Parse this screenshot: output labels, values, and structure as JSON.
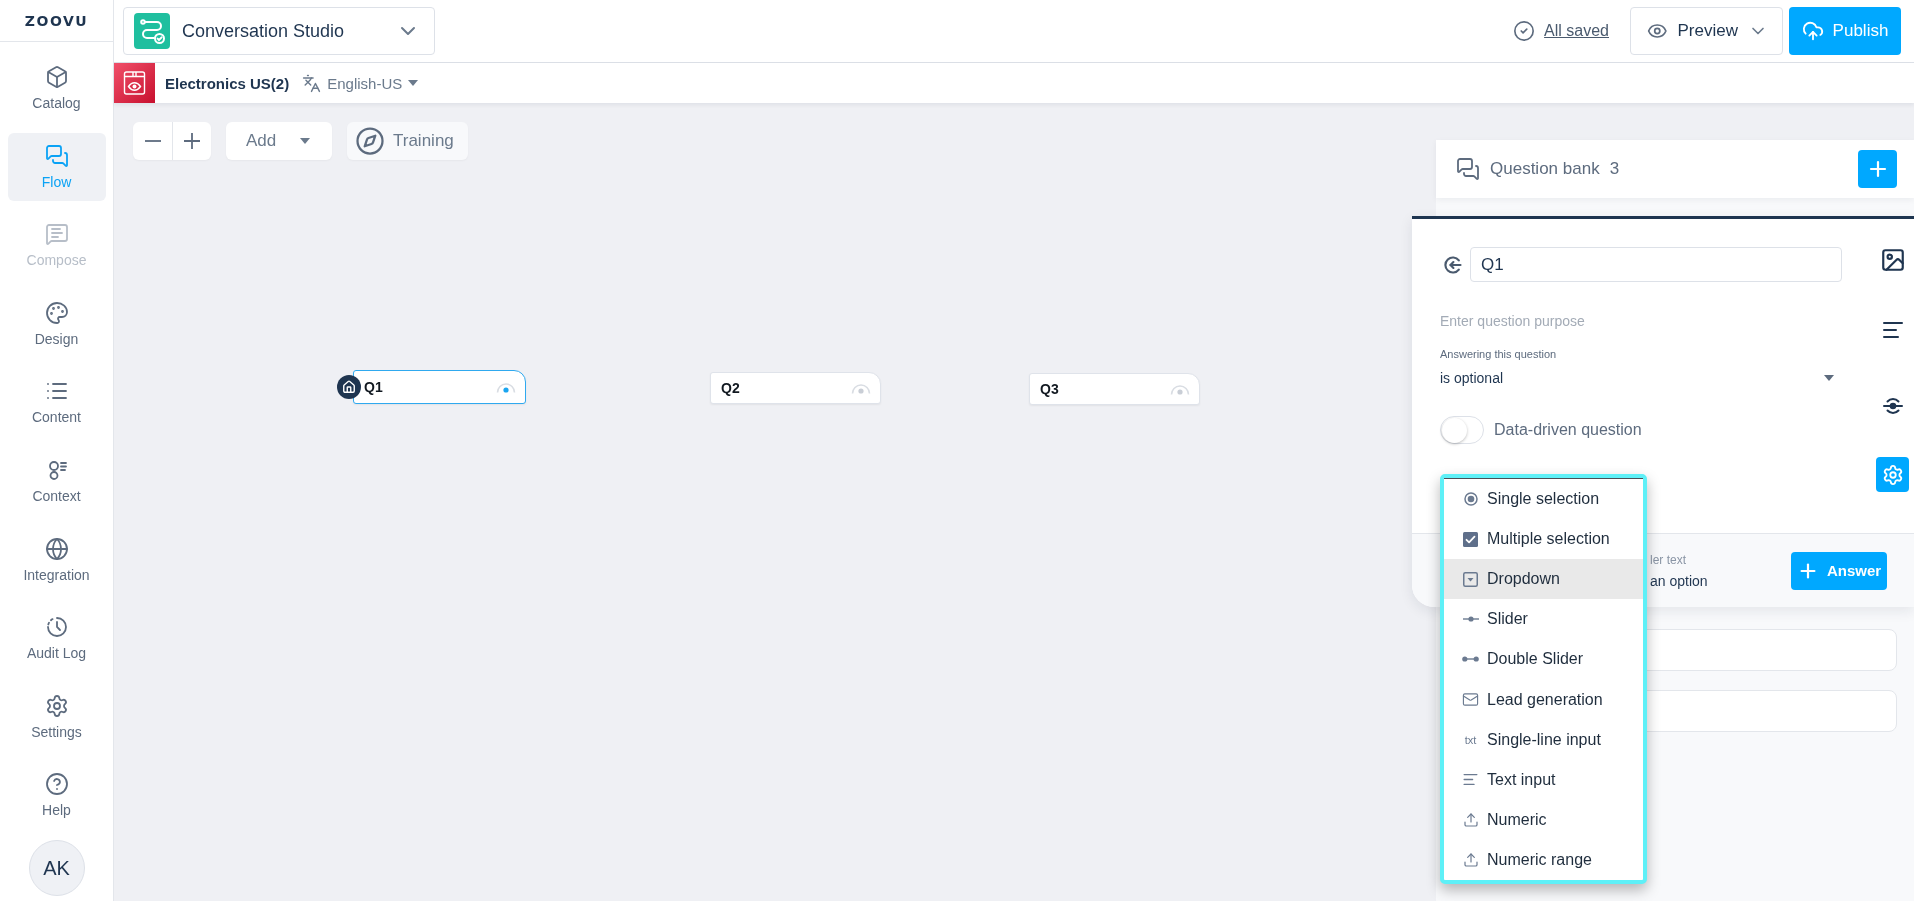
{
  "sidebar": {
    "logo": "ZOOVU",
    "items": [
      {
        "label": "Catalog",
        "selected": false,
        "disabled": false
      },
      {
        "label": "Flow",
        "selected": true,
        "disabled": false
      },
      {
        "label": "Compose",
        "selected": false,
        "disabled": true
      },
      {
        "label": "Design",
        "selected": false,
        "disabled": false
      },
      {
        "label": "Content",
        "selected": false,
        "disabled": false
      },
      {
        "label": "Context",
        "selected": false,
        "disabled": false
      },
      {
        "label": "Integration",
        "selected": false,
        "disabled": false
      },
      {
        "label": "Audit Log",
        "selected": false,
        "disabled": false
      },
      {
        "label": "Settings",
        "selected": false,
        "disabled": false
      },
      {
        "label": "Help",
        "selected": false,
        "disabled": false
      }
    ],
    "avatar": "AK"
  },
  "header": {
    "app_name": "Conversation Studio",
    "save_status": "All saved",
    "preview": "Preview",
    "publish": "Publish"
  },
  "subheader": {
    "catalog": "Electronics US(2)",
    "language": "English-US"
  },
  "toolbar": {
    "add": "Add",
    "training": "Training"
  },
  "canvas": {
    "nodes": [
      {
        "label": "Q1",
        "selected": true,
        "start": true
      },
      {
        "label": "Q2",
        "selected": false,
        "start": false
      },
      {
        "label": "Q3",
        "selected": false,
        "start": false
      }
    ]
  },
  "question_bank": {
    "title": "Question bank",
    "count": "3"
  },
  "editor": {
    "name": "Q1",
    "purpose_placeholder": "Enter question purpose",
    "answering_label": "Answering this question",
    "answering_value": "is optional",
    "data_driven": {
      "label": "Data-driven question",
      "on": false
    },
    "footer_hint": "ler text",
    "footer_value": "an option",
    "answer_button": "Answer"
  },
  "answer_type_menu": {
    "items": [
      {
        "label": "Single selection",
        "selected": false
      },
      {
        "label": "Multiple selection",
        "selected": false
      },
      {
        "label": "Dropdown",
        "selected": true
      },
      {
        "label": "Slider",
        "selected": false
      },
      {
        "label": "Double Slider",
        "selected": false
      },
      {
        "label": "Lead generation",
        "selected": false
      },
      {
        "label": "Single-line input",
        "selected": false,
        "icon_text": "txt"
      },
      {
        "label": "Text input",
        "selected": false
      },
      {
        "label": "Numeric",
        "selected": false
      },
      {
        "label": "Numeric range",
        "selected": false
      }
    ]
  }
}
